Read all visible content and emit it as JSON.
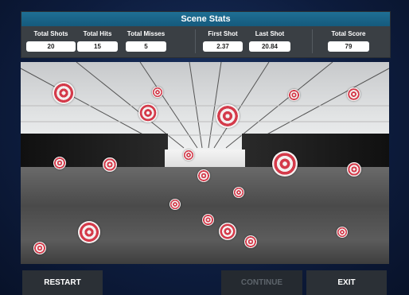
{
  "panel": {
    "title": "Scene Stats"
  },
  "stats": [
    {
      "label": "Total Shots",
      "value": "20"
    },
    {
      "label": "Total Hits",
      "value": "15"
    },
    {
      "label": "Total Misses",
      "value": "5"
    },
    {
      "label": "First Shot",
      "value": "2.37"
    },
    {
      "label": "Last Shot",
      "value": "20.84"
    },
    {
      "label": "Total Score",
      "value": "79"
    }
  ],
  "buttons": {
    "restart": "RESTART",
    "continue": "CONTINUE",
    "exit": "EXIT"
  },
  "targets_count": 22
}
